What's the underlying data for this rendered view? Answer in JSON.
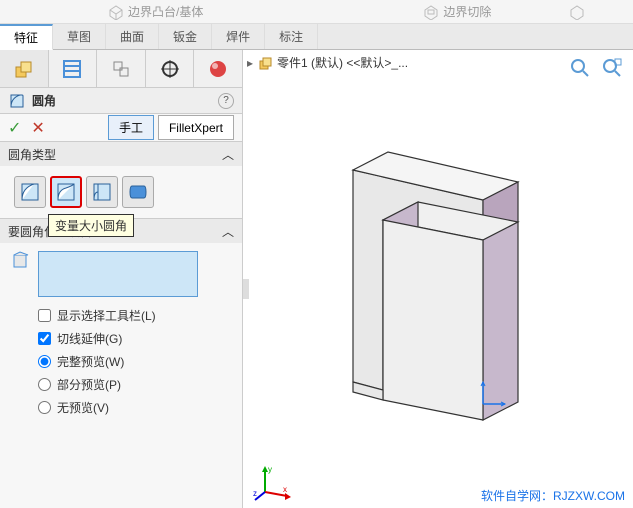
{
  "top": {
    "extrude": "边界凸台/基体",
    "cut": "边界切除"
  },
  "commandTabs": [
    "特征",
    "草图",
    "曲面",
    "钣金",
    "焊件",
    "标注"
  ],
  "commandTabActive": 0,
  "feature": {
    "title": "圆角",
    "help": "?",
    "ok": "✓",
    "cancel": "✕",
    "modes": {
      "manual": "手工",
      "xpert": "FilletXpert"
    }
  },
  "sections": {
    "filletType": {
      "title": "圆角类型",
      "chevron": "︿"
    },
    "itemsToFillet": {
      "title": "要圆角化的项目",
      "chevron": "︿"
    }
  },
  "filletTypes": {
    "tooltip": "变量大小圆角"
  },
  "options": {
    "showToolbar": "显示选择工具栏(L)",
    "tangent": "切线延伸(G)",
    "fullPreview": "完整预览(W)",
    "partialPreview": "部分预览(P)",
    "noPreview": "无预览(V)"
  },
  "optionState": {
    "showToolbar": false,
    "tangent": true,
    "preview": "full"
  },
  "tree": {
    "arrow": "▸",
    "partName": "零件1 (默认) <<默认>_..."
  },
  "csys": {
    "x": "x",
    "y": "y",
    "z": "z"
  },
  "watermark": "软件自学网：RJZXW.COM"
}
